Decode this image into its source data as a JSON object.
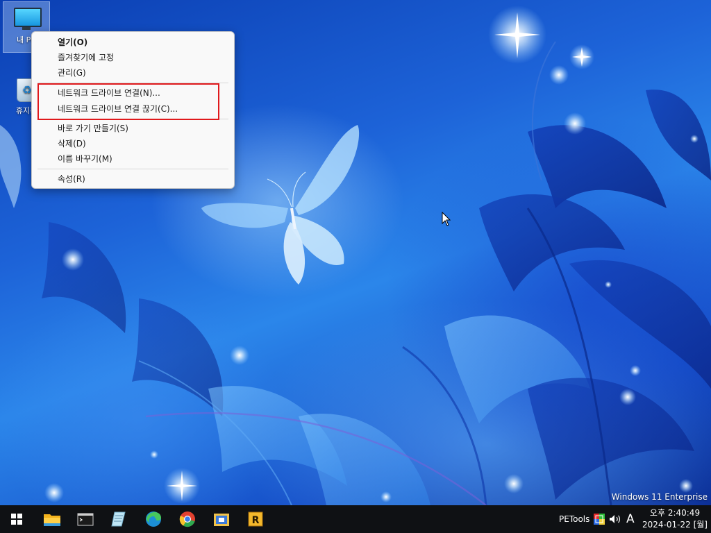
{
  "desktop": {
    "icons": [
      {
        "label": "내 PC",
        "icon": "monitor-icon"
      },
      {
        "label": "휴지통",
        "icon": "recycle-bin-icon"
      }
    ],
    "watermark": "Windows 11 Enterprise"
  },
  "context_menu": {
    "items": [
      {
        "label": "열기(O)",
        "bold": true
      },
      {
        "label": "즐겨찾기에 고정"
      },
      {
        "label": "관리(G)"
      },
      {
        "label": "네트워크 드라이브 연결(N)...",
        "highlighted": true
      },
      {
        "label": "네트워크 드라이브 연결 끊기(C)...",
        "highlighted": true
      },
      {
        "label": "바로 가기 만들기(S)"
      },
      {
        "label": "삭제(D)"
      },
      {
        "label": "이름 바꾸기(M)"
      },
      {
        "label": "속성(R)"
      }
    ],
    "highlight_color": "#e0191c"
  },
  "taskbar": {
    "apps": [
      {
        "icon": "windows-start-icon"
      },
      {
        "icon": "file-explorer-icon"
      },
      {
        "icon": "command-prompt-icon"
      },
      {
        "icon": "notepad-icon"
      },
      {
        "icon": "edge-browser-icon"
      },
      {
        "icon": "chrome-browser-icon"
      },
      {
        "icon": "app-folder-icon"
      },
      {
        "icon": "r-app-icon"
      }
    ],
    "tray": {
      "petools_label": "PETools",
      "ime_label": "A",
      "time": "오후 2:40:49",
      "date": "2024-01-22 [월]"
    }
  },
  "colors": {
    "taskbar_bg": "#0f1114",
    "menu_bg": "#f9f9f9",
    "desktop_blue": "#1d63d8"
  }
}
